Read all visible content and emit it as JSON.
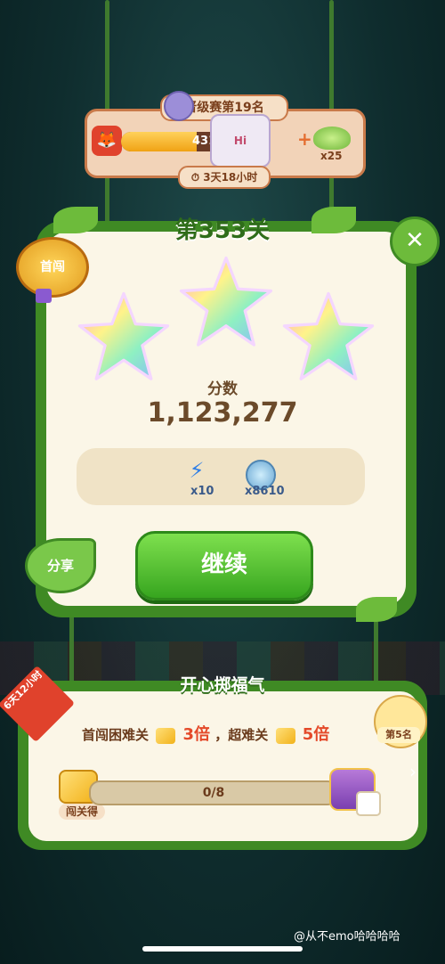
{
  "league": {
    "title": "晋级赛第19名",
    "progress_text": "431/66",
    "progress_fraction": 0.65,
    "card_text": "Hi",
    "reward_count": "x25",
    "timer": "3天18小时"
  },
  "level": {
    "title": "第353关",
    "badge_label": "首闯",
    "stars_earned": 3,
    "score_label": "分数",
    "score_value": "1,123,277"
  },
  "rewards": {
    "bolt_count": "x10",
    "coin_count": "x8610"
  },
  "buttons": {
    "share": "分享",
    "continue": "继续",
    "close": "✕"
  },
  "event": {
    "title": "开心掷福气",
    "ribbon": "6天12小时",
    "desc_prefix": "首闯困难关",
    "mult1": "3倍",
    "desc_mid": "，超难关",
    "mult2": "5倍",
    "rank": "第5名",
    "progress_text": "0/8",
    "progress_fraction": 0,
    "cheese_label": "闯关得"
  },
  "watermark": "@从不emo哈哈哈哈",
  "colors": {
    "panel_green": "#3f8a24",
    "cream": "#fbf6e7",
    "button_green": "#37a51f",
    "text_brown": "#6b4a2a",
    "highlight_red": "#e44a2a"
  }
}
